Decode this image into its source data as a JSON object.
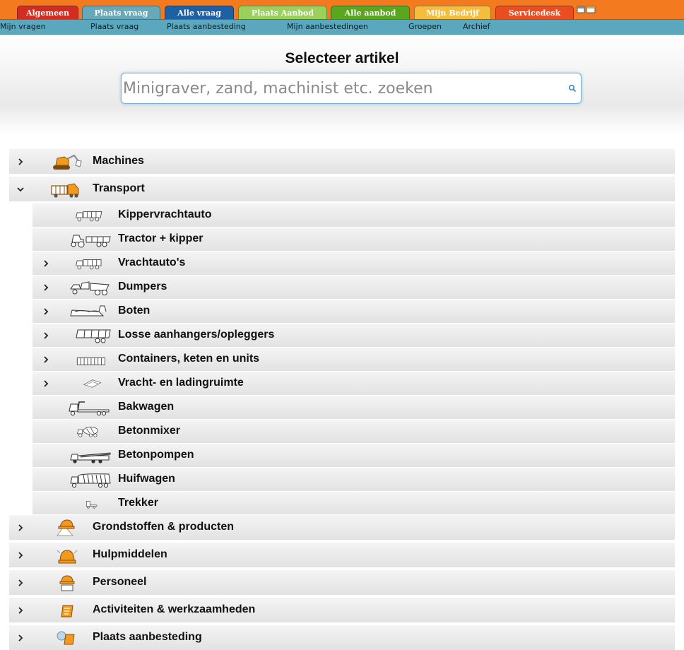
{
  "tabs": [
    {
      "label": "Algemeen",
      "color": "#d42d1f"
    },
    {
      "label": "Plaats vraag",
      "color": "#68a8b8"
    },
    {
      "label": "Alle vraag",
      "color": "#1f5fa3"
    },
    {
      "label": "Plaats Aanbod",
      "color": "#9bd05a"
    },
    {
      "label": "Alle aanbod",
      "color": "#5aa61e"
    },
    {
      "label": "Mijn Bedrijf",
      "color": "#f6bd3c"
    },
    {
      "label": "Servicedesk",
      "color": "#ec4d1e"
    }
  ],
  "subnav": [
    "Mijn vragen",
    "Plaats vraag",
    "Plaats aanbesteding",
    "Mijn aanbestedingen",
    "Groepen",
    "Archief"
  ],
  "search": {
    "title": "Selecteer artikel",
    "placeholder": "Minigraver, zand, machinist etc. zoeken"
  },
  "tree": {
    "top_before": [
      {
        "label": "Machines",
        "icon": "excavator-icon",
        "expanded": false
      }
    ],
    "transport": {
      "label": "Transport",
      "icon": "transport-truck-icon",
      "expanded": true
    },
    "children": [
      {
        "label": "Kippervrachtauto",
        "icon": "dump-truck-icon",
        "has_children": false
      },
      {
        "label": "Tractor + kipper",
        "icon": "tractor-trailer-icon",
        "has_children": false
      },
      {
        "label": "Vrachtauto's",
        "icon": "lorry-icon",
        "has_children": true
      },
      {
        "label": "Dumpers",
        "icon": "dumper-icon",
        "has_children": true
      },
      {
        "label": "Boten",
        "icon": "boat-icon",
        "has_children": true
      },
      {
        "label": "Losse aanhangers/opleggers",
        "icon": "trailer-icon",
        "has_children": true
      },
      {
        "label": "Containers, keten en units",
        "icon": "container-icon",
        "has_children": true
      },
      {
        "label": "Vracht- en ladingruimte",
        "icon": "cargo-space-icon",
        "has_children": true
      },
      {
        "label": "Bakwagen",
        "icon": "box-truck-icon",
        "has_children": false
      },
      {
        "label": "Betonmixer",
        "icon": "concrete-mixer-icon",
        "has_children": false
      },
      {
        "label": "Betonpompen",
        "icon": "concrete-pump-icon",
        "has_children": false
      },
      {
        "label": "Huifwagen",
        "icon": "tarp-truck-icon",
        "has_children": false
      },
      {
        "label": "Trekker",
        "icon": "tractor-unit-icon",
        "has_children": false
      }
    ],
    "top_after": [
      {
        "label": "Grondstoffen & producten",
        "icon": "raw-materials-icon"
      },
      {
        "label": "Hulpmiddelen",
        "icon": "tools-icon"
      },
      {
        "label": "Personeel",
        "icon": "worker-icon"
      },
      {
        "label": "Activiteiten & werkzaamheden",
        "icon": "activities-icon"
      },
      {
        "label": "Plaats aanbesteding",
        "icon": "tender-icon"
      }
    ]
  },
  "colors": {
    "accent": "#f47a1f",
    "subnav": "#5ba7bd",
    "icon_orange": "#f39a1c"
  }
}
